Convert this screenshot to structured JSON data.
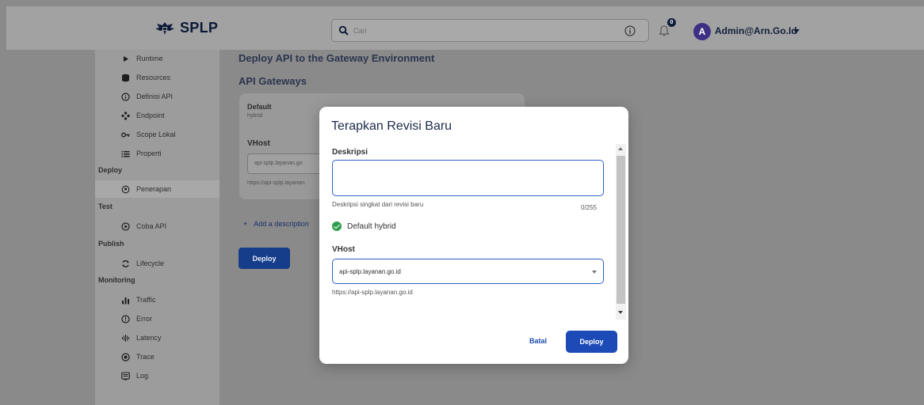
{
  "header": {
    "logo_text": "SPLP",
    "search_placeholder": "Cari",
    "notification_count": "0",
    "avatar_initial": "A",
    "user_name": "Admin@Arn.Go.Id"
  },
  "sidebar": {
    "items_top": [
      {
        "label": "Runtime",
        "icon": "play-icon"
      },
      {
        "label": "Resources",
        "icon": "database-icon"
      },
      {
        "label": "Definisi API",
        "icon": "info-icon"
      },
      {
        "label": "Endpoint",
        "icon": "endpoint-icon"
      },
      {
        "label": "Scope Lokal",
        "icon": "key-icon"
      },
      {
        "label": "Properti",
        "icon": "list-icon"
      }
    ],
    "sections": {
      "deploy": "Deploy",
      "test": "Test",
      "publish": "Publish",
      "monitoring": "Monitoring"
    },
    "deploy_items": [
      {
        "label": "Penerapan",
        "icon": "location-icon"
      }
    ],
    "test_items": [
      {
        "label": "Coba API",
        "icon": "play-circle-icon"
      }
    ],
    "publish_items": [
      {
        "label": "Lifecycle",
        "icon": "cycle-icon"
      }
    ],
    "monitoring_items": [
      {
        "label": "Traffic",
        "icon": "bar-chart-icon"
      },
      {
        "label": "Error",
        "icon": "error-icon"
      },
      {
        "label": "Latency",
        "icon": "latency-icon"
      },
      {
        "label": "Trace",
        "icon": "trace-icon"
      },
      {
        "label": "Log",
        "icon": "log-icon"
      }
    ]
  },
  "main": {
    "title": "Deploy API to the Gateway Environment",
    "subtitle": "API Gateways",
    "gateway_card": {
      "name": "Default",
      "type": "hybrid",
      "vhost_label": "VHost",
      "vhost_value": "api-splp.layanan.go",
      "vhost_url": "https://api-splp.layanan."
    },
    "add_description": "Add a description",
    "deploy_label": "Deploy"
  },
  "modal": {
    "title": "Terapkan Revisi Baru",
    "description_label": "Deskripsi",
    "description_value": "",
    "description_help": "Deskripsi singkat dari revisi baru",
    "description_count": "0/255",
    "default_label": "Default hybrid",
    "vhost_label": "VHost",
    "vhost_value": "api-splp.layanan.go.id",
    "vhost_url": "https://api-splp.layanan.go.id",
    "cancel_label": "Batal",
    "deploy_label": "Deploy"
  },
  "colors": {
    "primary": "#1c4bb8",
    "success": "#2e9e4e",
    "overlay": "#8a8a8a"
  }
}
